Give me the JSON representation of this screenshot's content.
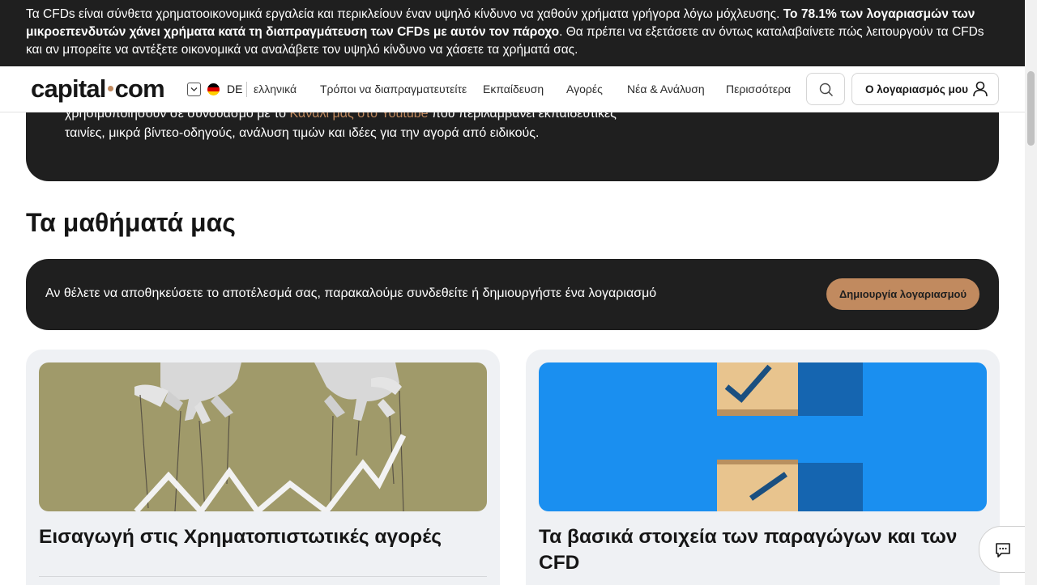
{
  "risk_banner": {
    "part1": "Τα CFDs είναι σύνθετα χρηματοοικονομικά εργαλεία και περικλείουν έναν υψηλό κίνδυνο να χαθούν χρήματα γρήγορα λόγω μόχλευσης. ",
    "bold": "Το 78.1% των λογαριασμών των μικροεπενδυτών χάνει χρήματα κατά τη διαπραγμάτευση των CFDs με αυτόν τον πάροχο",
    "part2": ". Θα πρέπει να εξετάσετε αν όντως καταλαβαίνετε πώς λειτουργούν τα CFDs και αν μπορείτε να αντέξετε οικονομικά να αναλάβετε τον υψηλό κίνδυνο να χάσετε τα χρήματά σας."
  },
  "header": {
    "logo_left": "capital",
    "logo_right": "com",
    "lang_code": "DE",
    "lang_name": "ελληνικά",
    "nav": [
      "Τρόποι να διαπραγματευτείτε",
      "Εκπαίδευση",
      "Αγορές",
      "Νέα & Ανάλυση",
      "Περισσότερα"
    ],
    "account_label": "Ο λογαριασμός μου"
  },
  "intro_panel": {
    "line1_start": "χρησιμοποιήσουν σε συνδυασμό με το ",
    "link": "Κανάλι μας στο Youtube",
    "line1_end": " που περιλαμβάνει εκπαιδευτικές",
    "line2": "ταινίες, μικρά βίντεο-οδηγούς, ανάλυση τιμών και ιδέες για την αγορά από ειδικούς."
  },
  "courses": {
    "title": "Τα μαθήματά μας",
    "login_message": "Αν θέλετε να αποθηκεύσετε το αποτέλεσμά σας, παρακαλούμε συνδεθείτε ή δημιουργήστε ένα λογαριασμό",
    "create_account_label": "Δημιουργία λογαριασμού",
    "cards": [
      {
        "title": "Εισαγωγή στις Χρηματοπιστωτικές αγορές",
        "image": "puppet-hands-chart-image"
      },
      {
        "title": "Τα βασικά στοιχεία των παραγώγων και των CFD",
        "image": "checkbox-ticks-image"
      }
    ]
  },
  "colors": {
    "accent": "#c18a5f",
    "dark": "#1f1f1f",
    "card_bg": "#eff1f4",
    "card1_image_bg": "#a09a6a",
    "card2_image_bg": "#1a8ff0"
  },
  "icons": {
    "search": "search-icon",
    "account": "user-icon",
    "chat": "chat-icon",
    "language": "chevron-down-icon"
  }
}
